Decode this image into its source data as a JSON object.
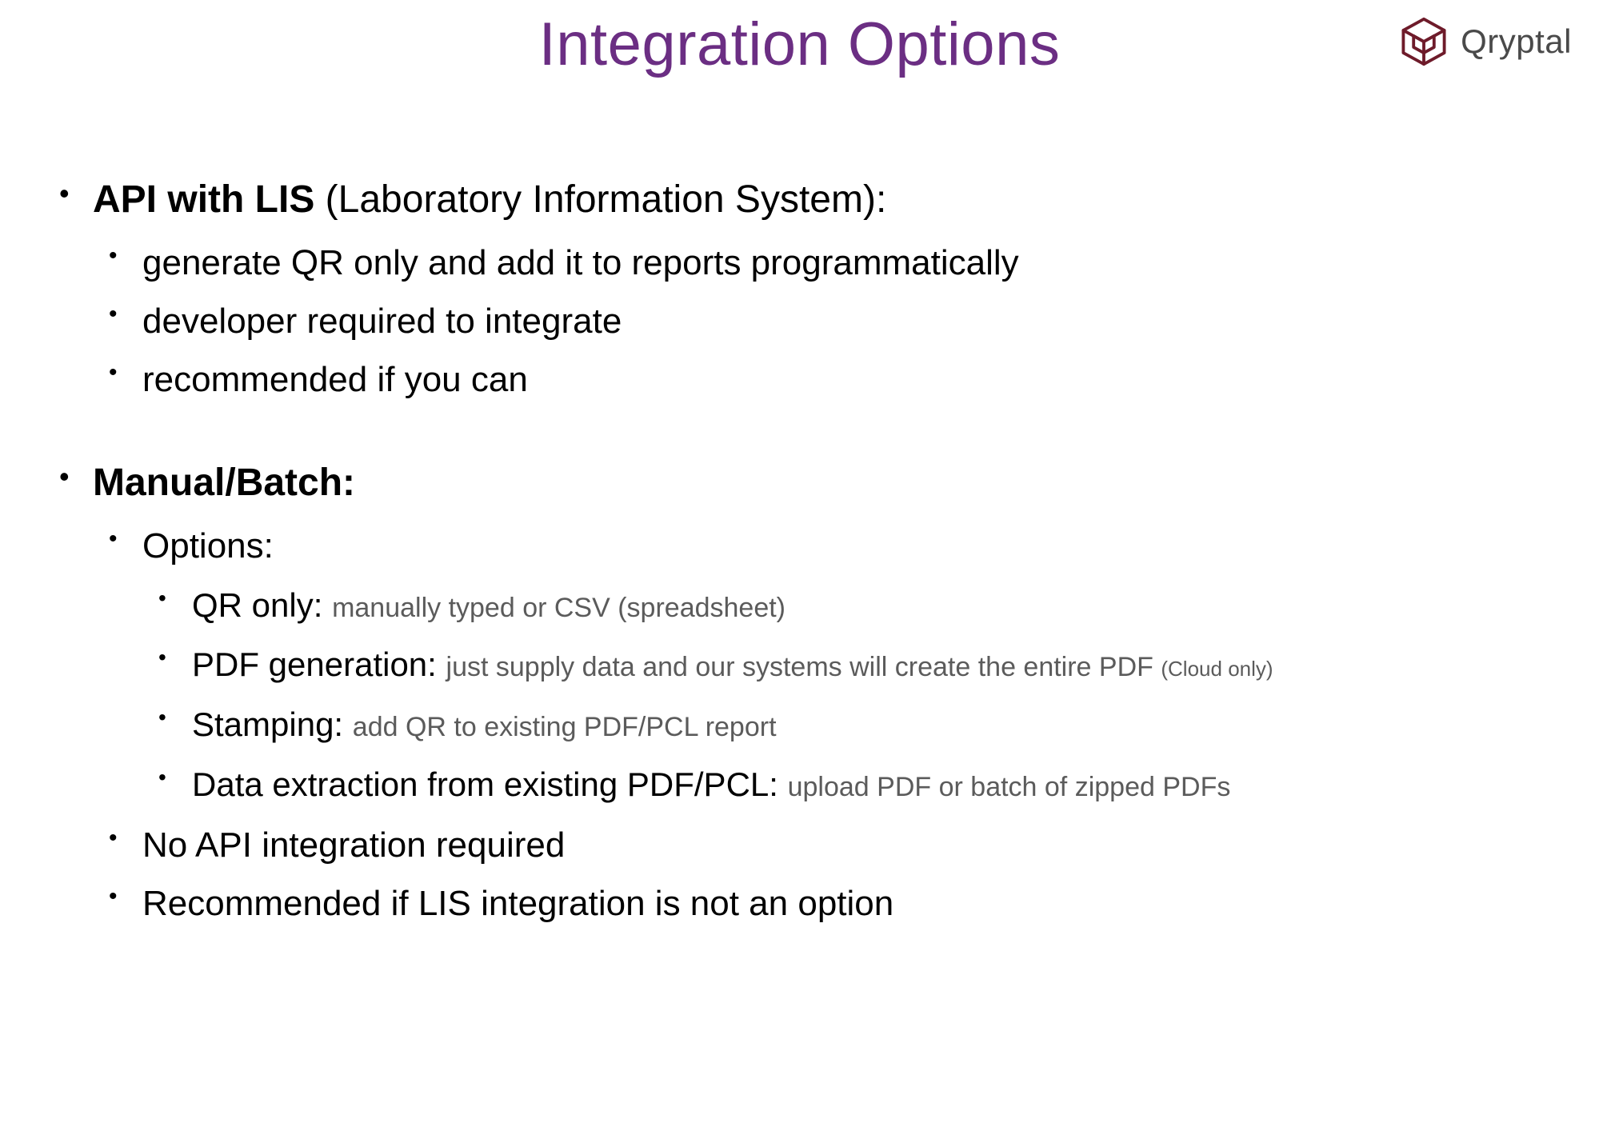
{
  "title": "Integration Options",
  "brand": "Qryptal",
  "sec1": {
    "head_bold": "API with LIS",
    "head_rest": " (Laboratory Information System):",
    "b1": "generate QR only and add it to reports programmatically",
    "b2": "developer required to integrate",
    "b3": "recommended if you can"
  },
  "sec2": {
    "head": "Manual/Batch:",
    "options_label": "Options:",
    "o1_head": "QR only: ",
    "o1_desc": "manually typed or CSV (spreadsheet)",
    "o2_head": "PDF generation: ",
    "o2_desc": "just supply data and our systems will create the entire PDF ",
    "o2_note": "(Cloud only)",
    "o3_head": "Stamping: ",
    "o3_desc": "add QR to existing PDF/PCL report",
    "o4_head": "Data extraction from existing PDF/PCL: ",
    "o4_desc": "upload PDF or batch of zipped PDFs",
    "b2": "No API integration required",
    "b3": "Recommended if LIS integration is not an option"
  }
}
